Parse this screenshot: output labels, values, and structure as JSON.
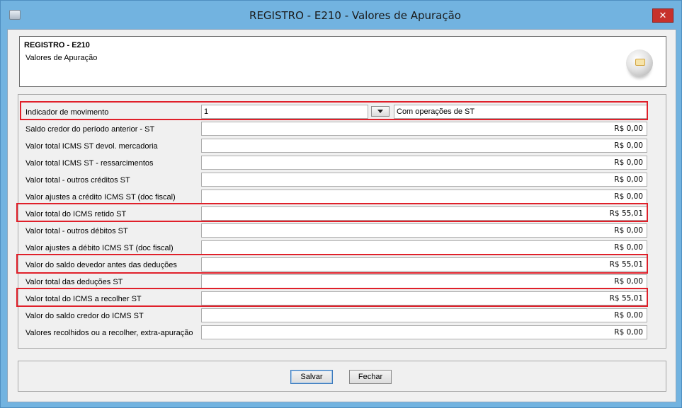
{
  "window": {
    "title": "REGISTRO - E210 - Valores de Apuração",
    "close_glyph": "✕"
  },
  "header": {
    "title": "REGISTRO - E210",
    "subtitle": "Valores de Apuração"
  },
  "indicador": {
    "label": "Indicador de movimento",
    "code": "1",
    "description": "Com operações de ST"
  },
  "rows": [
    {
      "label": "Saldo credor do período anterior - ST",
      "value": "R$ 0,00"
    },
    {
      "label": "Valor total ICMS ST devol. mercadoria",
      "value": "R$ 0,00"
    },
    {
      "label": "Valor total ICMS ST - ressarcimentos",
      "value": "R$ 0,00"
    },
    {
      "label": "Valor total - outros créditos ST",
      "value": "R$ 0,00"
    },
    {
      "label": "Valor ajustes a crédito ICMS ST (doc fiscal)",
      "value": "R$ 0,00"
    },
    {
      "label": "Valor total do ICMS retido ST",
      "value": "R$ 55,01"
    },
    {
      "label": "Valor total - outros débitos ST",
      "value": "R$ 0,00"
    },
    {
      "label": "Valor ajustes a débito ICMS ST (doc fiscal)",
      "value": "R$ 0,00"
    },
    {
      "label": "Valor do saldo devedor antes das deduções",
      "value": "R$ 55,01"
    },
    {
      "label": "Valor total das deduções ST",
      "value": "R$ 0,00"
    },
    {
      "label": "Valor total do ICMS a recolher ST",
      "value": "R$ 55,01"
    },
    {
      "label": "Valor do saldo credor do ICMS ST",
      "value": "R$ 0,00"
    },
    {
      "label": "Valores recolhidos ou a recolher, extra-apuração",
      "value": "R$ 0,00"
    }
  ],
  "buttons": {
    "save": "Salvar",
    "close": "Fechar"
  },
  "colors": {
    "highlight": "#e0202a",
    "title_bar": "#72b3e0"
  }
}
